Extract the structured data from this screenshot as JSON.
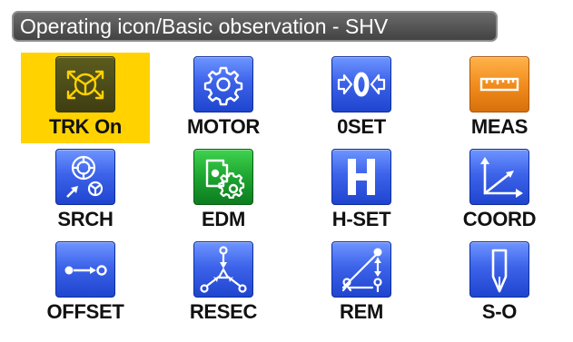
{
  "window": {
    "title": "Operating icon/Basic observation - SHV"
  },
  "tiles": [
    {
      "label": "TRK On",
      "icon": "tracking-icon",
      "color": "dark",
      "selected": true
    },
    {
      "label": "MOTOR",
      "icon": "motor-gear-icon",
      "color": "blue",
      "selected": false
    },
    {
      "label": "0SET",
      "icon": "zero-set-icon",
      "color": "blue",
      "selected": false
    },
    {
      "label": "MEAS",
      "icon": "ruler-icon",
      "color": "orange",
      "selected": false
    },
    {
      "label": "SRCH",
      "icon": "search-target-icon",
      "color": "blue",
      "selected": false
    },
    {
      "label": "EDM",
      "icon": "edm-settings-icon",
      "color": "green",
      "selected": false
    },
    {
      "label": "H-SET",
      "icon": "h-letter-icon",
      "color": "blue",
      "selected": false
    },
    {
      "label": "COORD",
      "icon": "coordinate-axes-icon",
      "color": "blue",
      "selected": false
    },
    {
      "label": "OFFSET",
      "icon": "offset-arrow-icon",
      "color": "blue",
      "selected": false
    },
    {
      "label": "RESEC",
      "icon": "resection-icon",
      "color": "blue",
      "selected": false
    },
    {
      "label": "REM",
      "icon": "remote-elevation-icon",
      "color": "blue",
      "selected": false
    },
    {
      "label": "S-O",
      "icon": "stakeout-pole-icon",
      "color": "blue",
      "selected": false
    }
  ],
  "colors": {
    "highlight": "#ffd200",
    "tile_blue": "#3d63ea",
    "tile_green": "#1da531",
    "tile_orange": "#f08a1b",
    "tile_dark": "#3e3e12",
    "titlebar": "#555555"
  }
}
